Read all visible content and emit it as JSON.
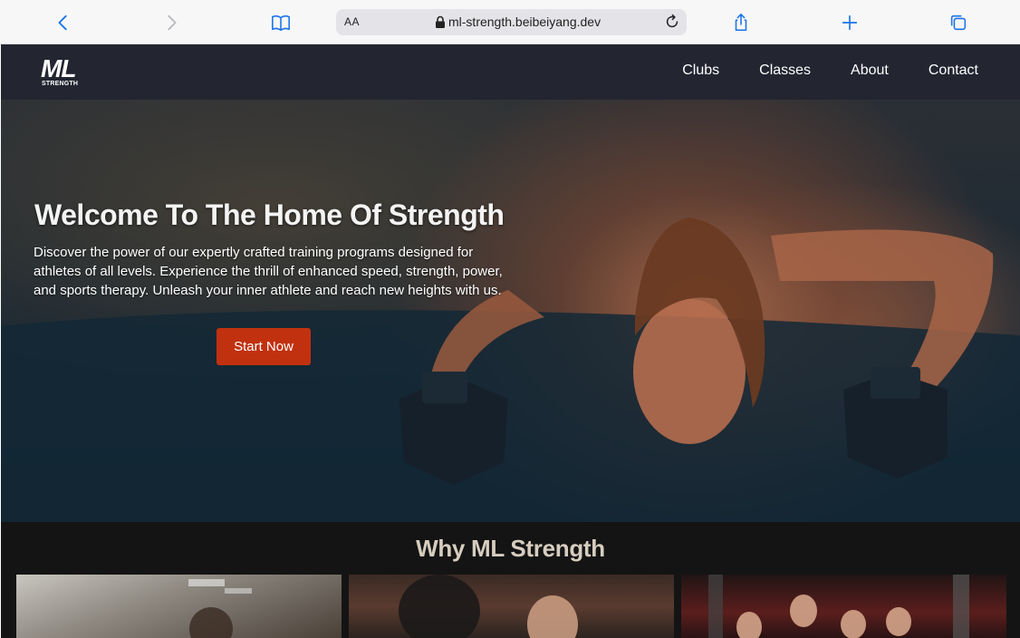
{
  "browser": {
    "text_size_label": "AA",
    "url": "ml-strength.beibeiyang.dev"
  },
  "site": {
    "logo_main": "ML",
    "logo_sub": "STRENGTH",
    "nav": [
      "Clubs",
      "Classes",
      "About",
      "Contact"
    ]
  },
  "hero": {
    "title": "Welcome To The Home Of Strength",
    "text": "Discover the power of our expertly crafted training programs designed for athletes of all levels. Experience the thrill of enhanced speed, strength, power, and sports therapy. Unleash your inner athlete and reach new heights with us.",
    "cta": "Start Now"
  },
  "why": {
    "title": "Why ML Strength"
  },
  "colors": {
    "nav_bg": "#232531",
    "cta_bg": "#c1310f",
    "browser_accent": "#1a73e8",
    "section_title": "#d7cdbf"
  }
}
